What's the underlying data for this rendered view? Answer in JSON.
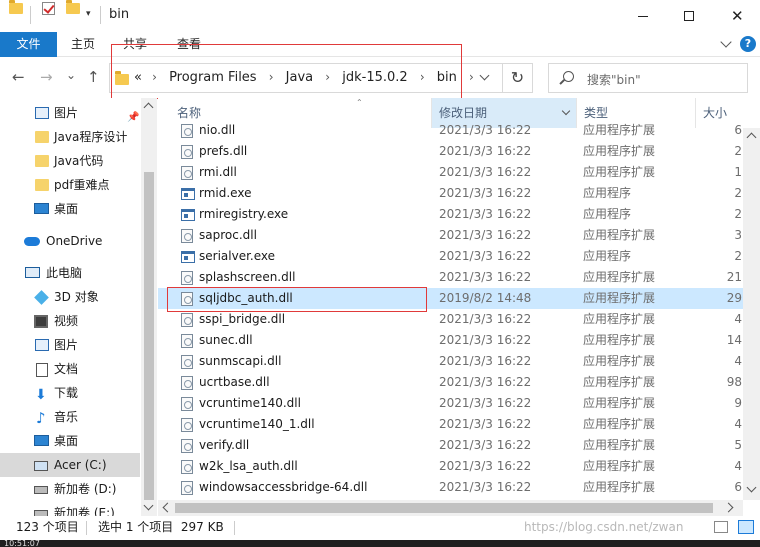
{
  "window": {
    "title": "bin",
    "minimize_glyph": "—",
    "close_glyph": "✕"
  },
  "ribbon": {
    "tabs": [
      "文件",
      "主页",
      "共享",
      "查看"
    ],
    "help_glyph": "?"
  },
  "nav": {
    "back_glyph": "←",
    "forward_glyph": "→",
    "recent_glyph": "⌄",
    "up_glyph": "↑",
    "breadcrumbs": [
      "Program Files",
      "Java",
      "jdk-15.0.2",
      "bin"
    ],
    "overflow": "«",
    "refresh_glyph": "↻",
    "search_placeholder": "搜索\"bin\""
  },
  "sidebar": {
    "items": [
      {
        "label": "图片",
        "icon": "picture-icon",
        "pinned": true
      },
      {
        "label": "Java程序设计",
        "icon": "folder-icon"
      },
      {
        "label": "Java代码",
        "icon": "folder-icon"
      },
      {
        "label": "pdf重难点",
        "icon": "folder-icon"
      },
      {
        "label": "桌面",
        "icon": "desktop-icon"
      },
      {
        "label": "OneDrive",
        "icon": "cloud-icon"
      },
      {
        "label": "此电脑",
        "icon": "computer-icon"
      },
      {
        "label": "3D 对象",
        "icon": "3d-objects-icon"
      },
      {
        "label": "视频",
        "icon": "video-icon"
      },
      {
        "label": "图片",
        "icon": "picture-icon"
      },
      {
        "label": "文档",
        "icon": "document-icon"
      },
      {
        "label": "下载",
        "icon": "download-icon"
      },
      {
        "label": "音乐",
        "icon": "music-icon"
      },
      {
        "label": "桌面",
        "icon": "desktop-icon"
      },
      {
        "label": "Acer (C:)",
        "icon": "drive-icon",
        "selected": true
      },
      {
        "label": "新加卷 (D:)",
        "icon": "drive-icon"
      },
      {
        "label": "新加卷 (E:)",
        "icon": "drive-icon"
      }
    ],
    "pin_glyph": "📌"
  },
  "columns": {
    "name": "名称",
    "date": "修改日期",
    "type": "类型",
    "size": "大小"
  },
  "files": [
    {
      "name": "nio.dll",
      "date": "2021/3/3 16:22",
      "type": "应用程序扩展",
      "size": "6",
      "kind": "dll"
    },
    {
      "name": "prefs.dll",
      "date": "2021/3/3 16:22",
      "type": "应用程序扩展",
      "size": "2",
      "kind": "dll"
    },
    {
      "name": "rmi.dll",
      "date": "2021/3/3 16:22",
      "type": "应用程序扩展",
      "size": "1",
      "kind": "dll"
    },
    {
      "name": "rmid.exe",
      "date": "2021/3/3 16:22",
      "type": "应用程序",
      "size": "2",
      "kind": "exe"
    },
    {
      "name": "rmiregistry.exe",
      "date": "2021/3/3 16:22",
      "type": "应用程序",
      "size": "2",
      "kind": "exe"
    },
    {
      "name": "saproc.dll",
      "date": "2021/3/3 16:22",
      "type": "应用程序扩展",
      "size": "3",
      "kind": "dll"
    },
    {
      "name": "serialver.exe",
      "date": "2021/3/3 16:22",
      "type": "应用程序",
      "size": "2",
      "kind": "exe"
    },
    {
      "name": "splashscreen.dll",
      "date": "2021/3/3 16:22",
      "type": "应用程序扩展",
      "size": "21",
      "kind": "dll"
    },
    {
      "name": "sqljdbc_auth.dll",
      "date": "2019/8/2 14:48",
      "type": "应用程序扩展",
      "size": "29",
      "kind": "dll",
      "selected": true
    },
    {
      "name": "sspi_bridge.dll",
      "date": "2021/3/3 16:22",
      "type": "应用程序扩展",
      "size": "4",
      "kind": "dll"
    },
    {
      "name": "sunec.dll",
      "date": "2021/3/3 16:22",
      "type": "应用程序扩展",
      "size": "14",
      "kind": "dll"
    },
    {
      "name": "sunmscapi.dll",
      "date": "2021/3/3 16:22",
      "type": "应用程序扩展",
      "size": "4",
      "kind": "dll"
    },
    {
      "name": "ucrtbase.dll",
      "date": "2021/3/3 16:22",
      "type": "应用程序扩展",
      "size": "98",
      "kind": "dll"
    },
    {
      "name": "vcruntime140.dll",
      "date": "2021/3/3 16:22",
      "type": "应用程序扩展",
      "size": "9",
      "kind": "dll"
    },
    {
      "name": "vcruntime140_1.dll",
      "date": "2021/3/3 16:22",
      "type": "应用程序扩展",
      "size": "4",
      "kind": "dll"
    },
    {
      "name": "verify.dll",
      "date": "2021/3/3 16:22",
      "type": "应用程序扩展",
      "size": "5",
      "kind": "dll"
    },
    {
      "name": "w2k_lsa_auth.dll",
      "date": "2021/3/3 16:22",
      "type": "应用程序扩展",
      "size": "4",
      "kind": "dll"
    },
    {
      "name": "windowsaccessbridge-64.dll",
      "date": "2021/3/3 16:22",
      "type": "应用程序扩展",
      "size": "6",
      "kind": "dll"
    }
  ],
  "status": {
    "count": "123 个项目",
    "selection": "选中 1 个项目  297 KB",
    "watermark": "https://blog.csdn.net/zwan"
  },
  "taskbar": {
    "text": "10:51:07"
  },
  "colors": {
    "accent": "#1979ca",
    "selection": "#cce8ff",
    "highlight_border": "#e03a3a"
  }
}
